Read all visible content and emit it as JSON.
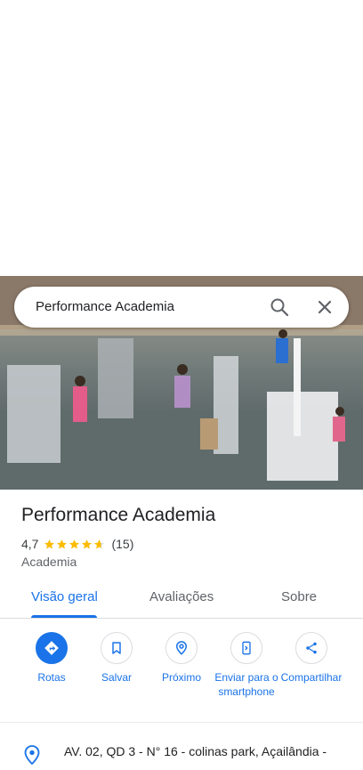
{
  "search": {
    "query": "Performance Academia"
  },
  "place": {
    "name": "Performance Academia",
    "rating": "4,7",
    "rating_value": 4.7,
    "reviews": "(15)",
    "category": "Academia"
  },
  "tabs": [
    {
      "label": "Visão geral",
      "active": true
    },
    {
      "label": "Avaliações",
      "active": false
    },
    {
      "label": "Sobre",
      "active": false
    }
  ],
  "actions": [
    {
      "label": "Rotas",
      "icon": "directions-icon"
    },
    {
      "label": "Salvar",
      "icon": "bookmark-icon"
    },
    {
      "label": "Próximo",
      "icon": "nearby-icon"
    },
    {
      "label": "Enviar para o smartphone",
      "icon": "send-to-phone-icon"
    },
    {
      "label": "Compartilhar",
      "icon": "share-icon"
    }
  ],
  "address": {
    "text": "AV. 02, QD 3 - N° 16 - colinas park, Açailândia -"
  },
  "colors": {
    "accent": "#1a73e8",
    "star": "#fbbc04"
  }
}
